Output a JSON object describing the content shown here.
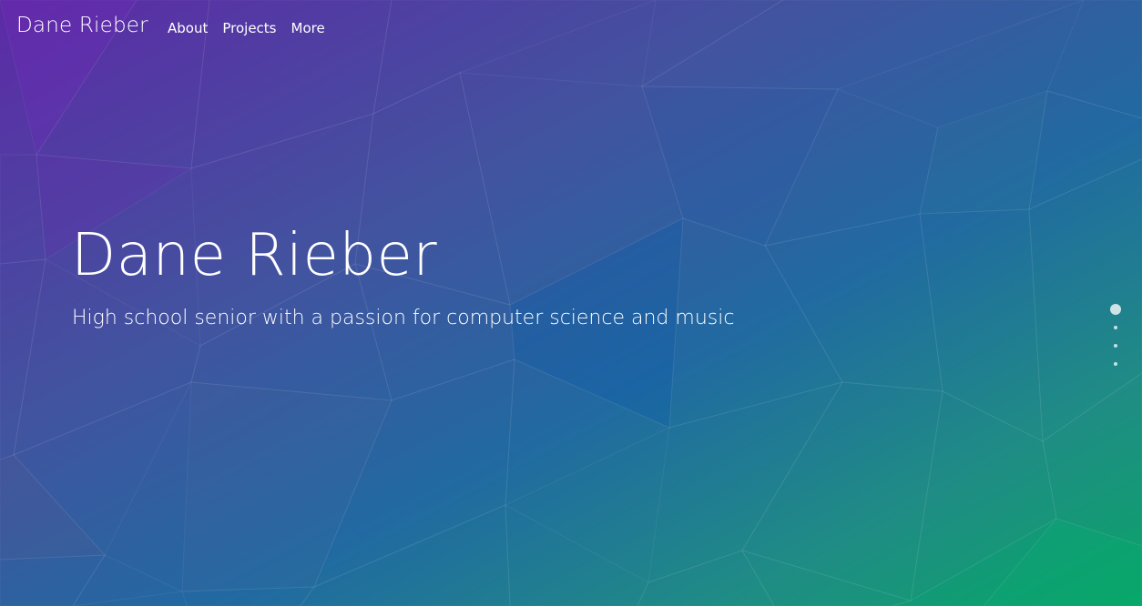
{
  "nav": {
    "brand": "Dane Rieber",
    "links": [
      "About",
      "Projects",
      "More"
    ]
  },
  "hero": {
    "title": "Dane Rieber",
    "subtitle": "High school senior with a passion for computer science and music"
  },
  "page_indicator": {
    "count": 4,
    "active_index": 0
  },
  "colors": {
    "purple": "#5a2ea3",
    "blue": "#1f63a6",
    "teal": "#217f8d",
    "green": "#08a06b",
    "text": "#ffffff"
  }
}
